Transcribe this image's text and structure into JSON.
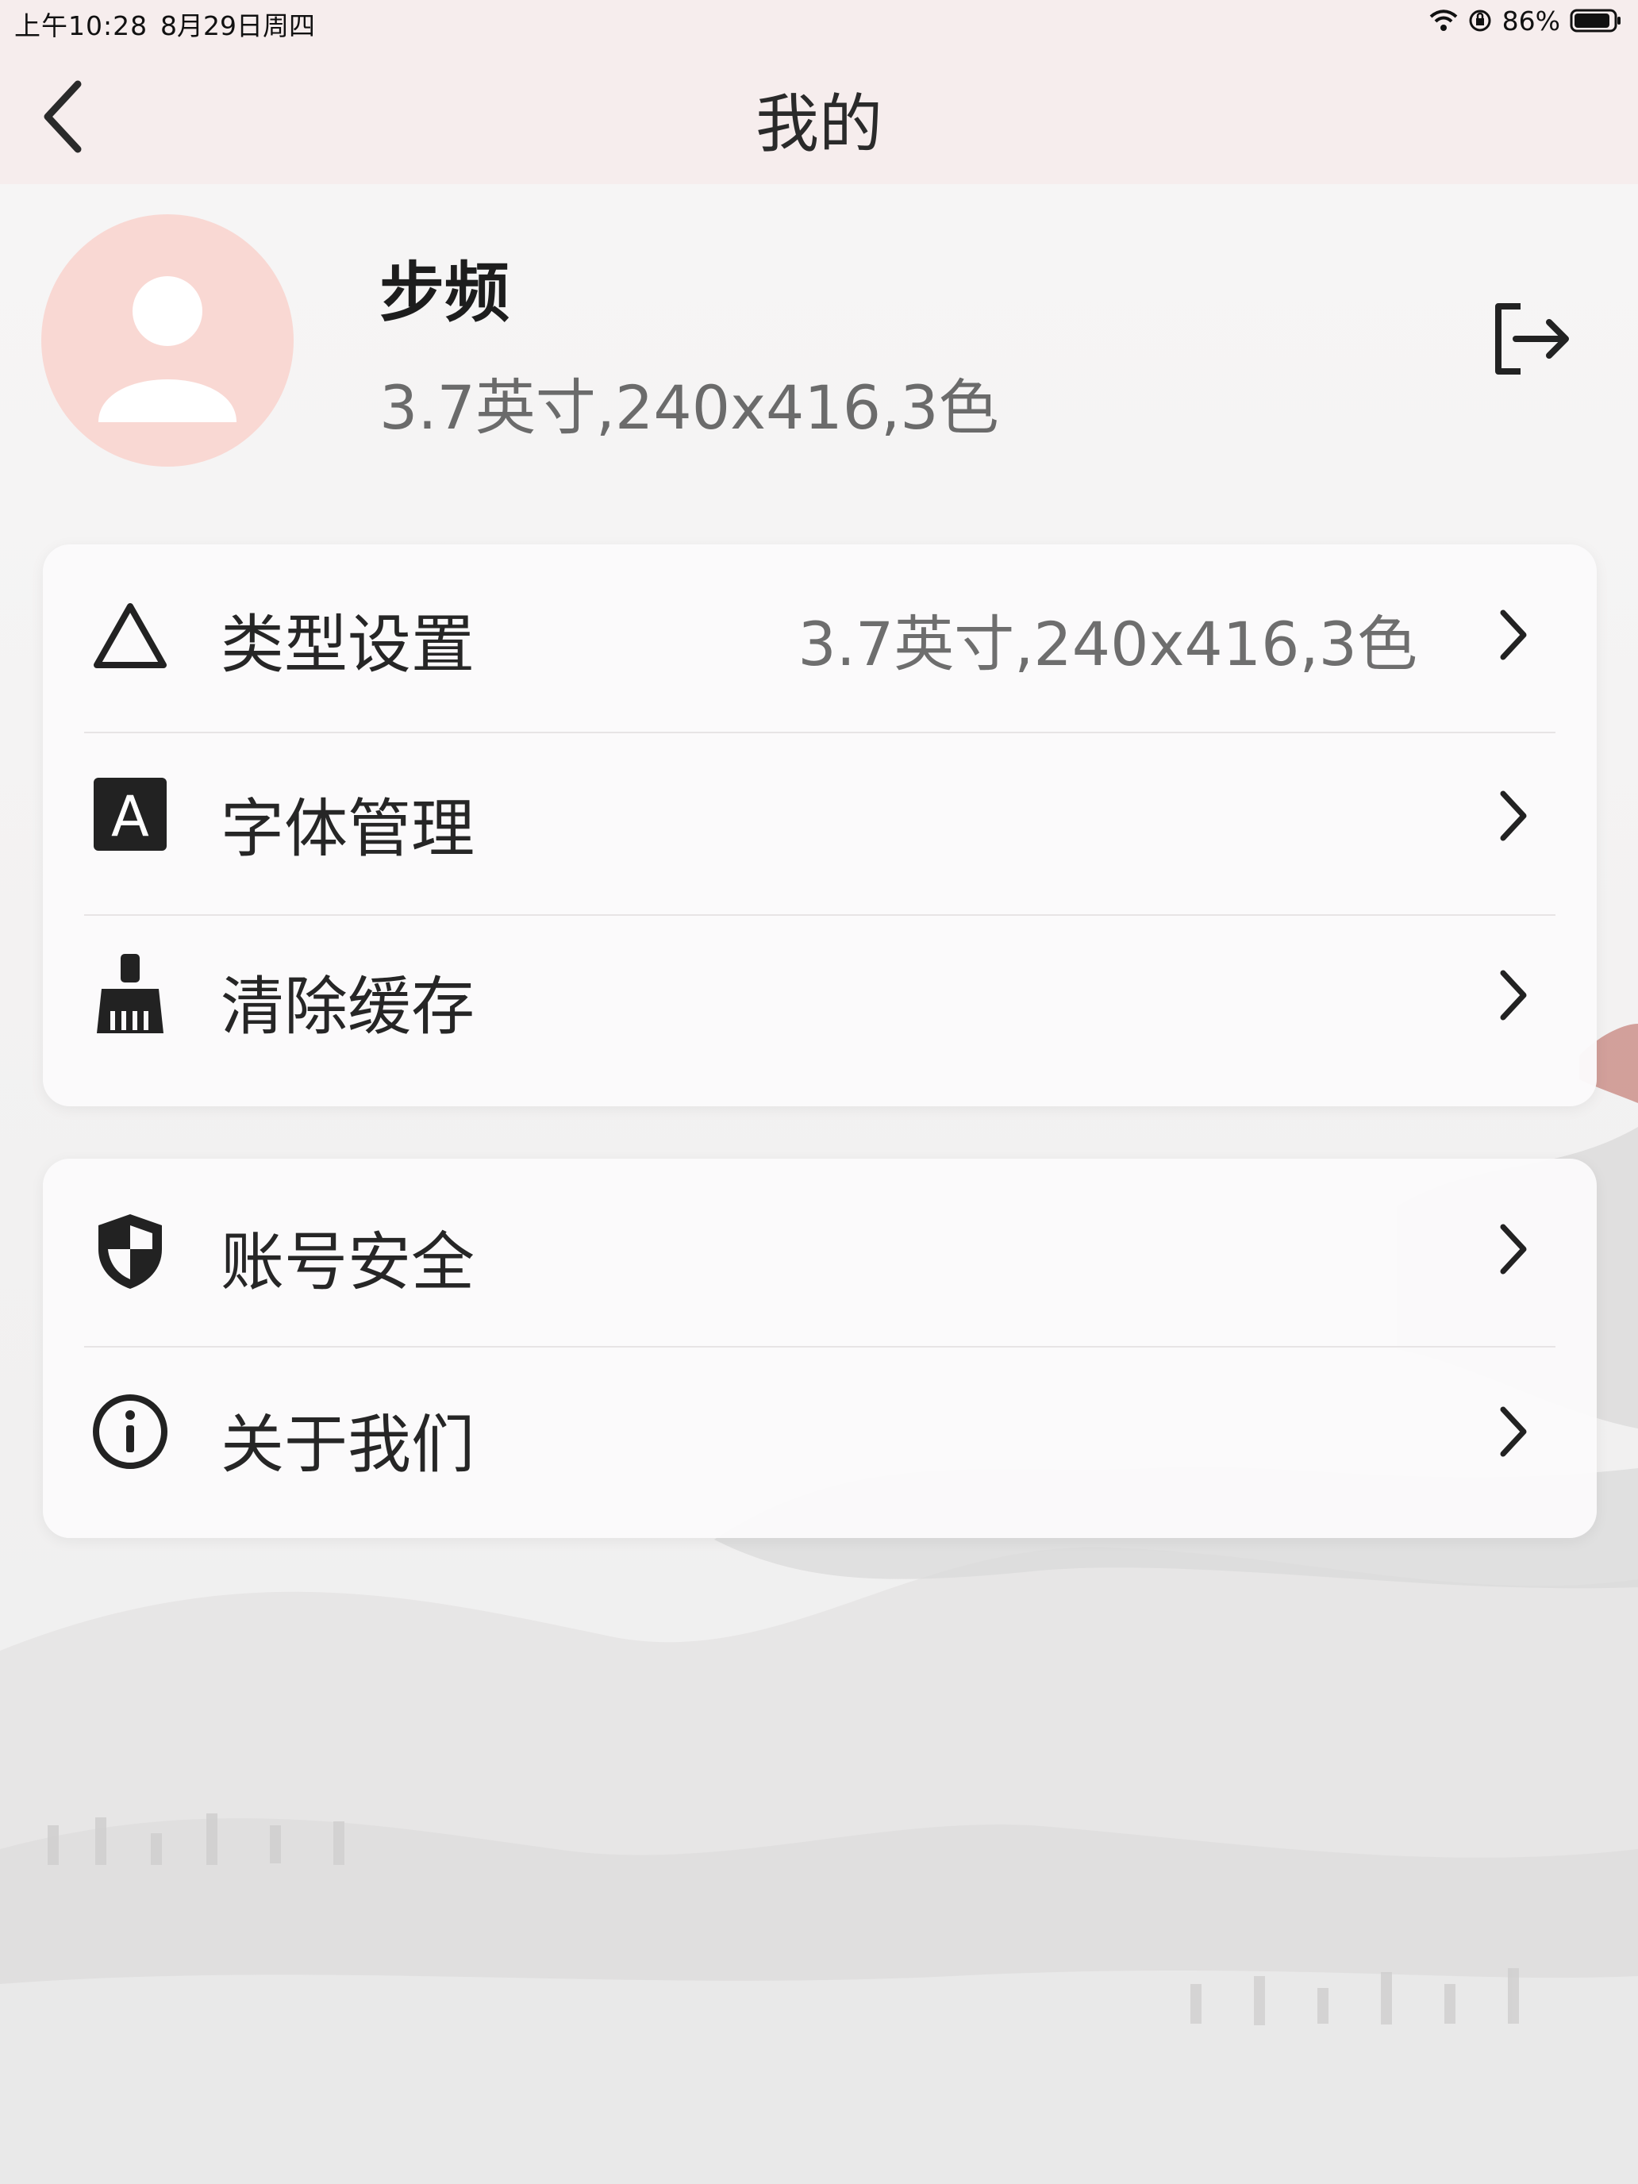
{
  "status_bar": {
    "time": "上午10:28",
    "date": "8月29日周四",
    "battery_percent": "86%",
    "icons": [
      "wifi-icon",
      "orientation-lock-icon",
      "battery-icon"
    ]
  },
  "header": {
    "title": "我的",
    "back_icon": "chevron-left-icon",
    "background": "#f6eded"
  },
  "profile": {
    "name": "步频",
    "device_desc": "3.7英寸,240x416,3色",
    "avatar_icon": "user-avatar-icon",
    "avatar_color": "#f9d8d3",
    "logout_icon": "logout-icon"
  },
  "settings_group_1": [
    {
      "label": "类型设置",
      "value": "3.7英寸,240x416,3色",
      "icon": "triangle-icon"
    },
    {
      "label": "字体管理",
      "value": "",
      "icon": "font-a-icon"
    },
    {
      "label": "清除缓存",
      "value": "",
      "icon": "broom-icon"
    }
  ],
  "settings_group_2": [
    {
      "label": "账号安全",
      "value": "",
      "icon": "shield-icon"
    },
    {
      "label": "关于我们",
      "value": "",
      "icon": "info-icon"
    }
  ]
}
